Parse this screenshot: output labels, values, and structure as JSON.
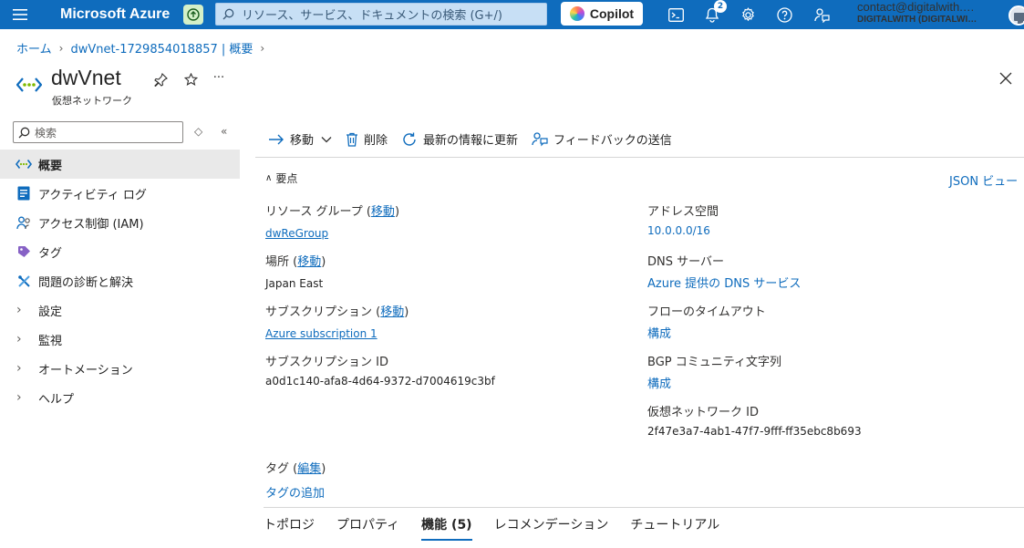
{
  "topbar": {
    "brand": "Microsoft Azure",
    "search_placeholder": "リソース、サービス、ドキュメントの検索 (G+/)",
    "copilot_label": "Copilot",
    "notification_count": "2",
    "account_email": "contact@digitalwith.…",
    "account_tenant": "DIGITALWITH (DIGITALWI…"
  },
  "breadcrumb": {
    "home": "ホーム",
    "resource": "dwVnet-1729854018857 | 概要"
  },
  "resource": {
    "title": "dwVnet",
    "subtitle": "仮想ネットワーク",
    "more": "···"
  },
  "sidebar": {
    "search_placeholder": "検索",
    "items": [
      {
        "label": "概要",
        "icon": "vnet-icon",
        "active": true
      },
      {
        "label": "アクティビティ ログ",
        "icon": "activity-log-icon"
      },
      {
        "label": "アクセス制御 (IAM)",
        "icon": "iam-icon"
      },
      {
        "label": "タグ",
        "icon": "tag-icon"
      },
      {
        "label": "問題の診断と解決",
        "icon": "wrench-icon"
      },
      {
        "label": "設定",
        "icon": "chevron-right-icon"
      },
      {
        "label": "監視",
        "icon": "chevron-right-icon"
      },
      {
        "label": "オートメーション",
        "icon": "chevron-right-icon"
      },
      {
        "label": "ヘルプ",
        "icon": "chevron-right-icon"
      }
    ]
  },
  "commands": {
    "move": "移動",
    "delete": "削除",
    "refresh": "最新の情報に更新",
    "feedback": "フィードバックの送信"
  },
  "essentials": {
    "header": "要点",
    "json_view": "JSON ビュー",
    "move_link": "移動",
    "edit_link": "編集",
    "left": {
      "resource_group_label": "リソース グループ",
      "resource_group_value": "dwReGroup",
      "location_label": "場所",
      "location_value": "Japan East",
      "subscription_label": "サブスクリプション",
      "subscription_value": "Azure subscription 1",
      "subscription_id_label": "サブスクリプション ID",
      "subscription_id_value": "a0d1c140-afa8-4d64-9372-d7004619c3bf"
    },
    "right": {
      "address_space_label": "アドレス空間",
      "address_space_value": "10.0.0.0/16",
      "dns_label": "DNS サーバー",
      "dns_value": "Azure 提供の DNS サービス",
      "flow_timeout_label": "フローのタイムアウト",
      "flow_timeout_value": "構成",
      "bgp_label": "BGP コミュニティ文字列",
      "bgp_value": "構成",
      "vnet_id_label": "仮想ネットワーク ID",
      "vnet_id_value": "2f47e3a7-4ab1-47f7-9fff-ff35ebc8b693"
    },
    "tags_label": "タグ",
    "tags_add": "タグの追加"
  },
  "tabs": [
    {
      "label": "トポロジ"
    },
    {
      "label": "プロパティ"
    },
    {
      "label": "機能 (5)",
      "active": true
    },
    {
      "label": "レコメンデーション"
    },
    {
      "label": "チュートリアル"
    }
  ],
  "colors": {
    "accent": "#0f6cbd",
    "topbar": "#0f6cbd"
  }
}
